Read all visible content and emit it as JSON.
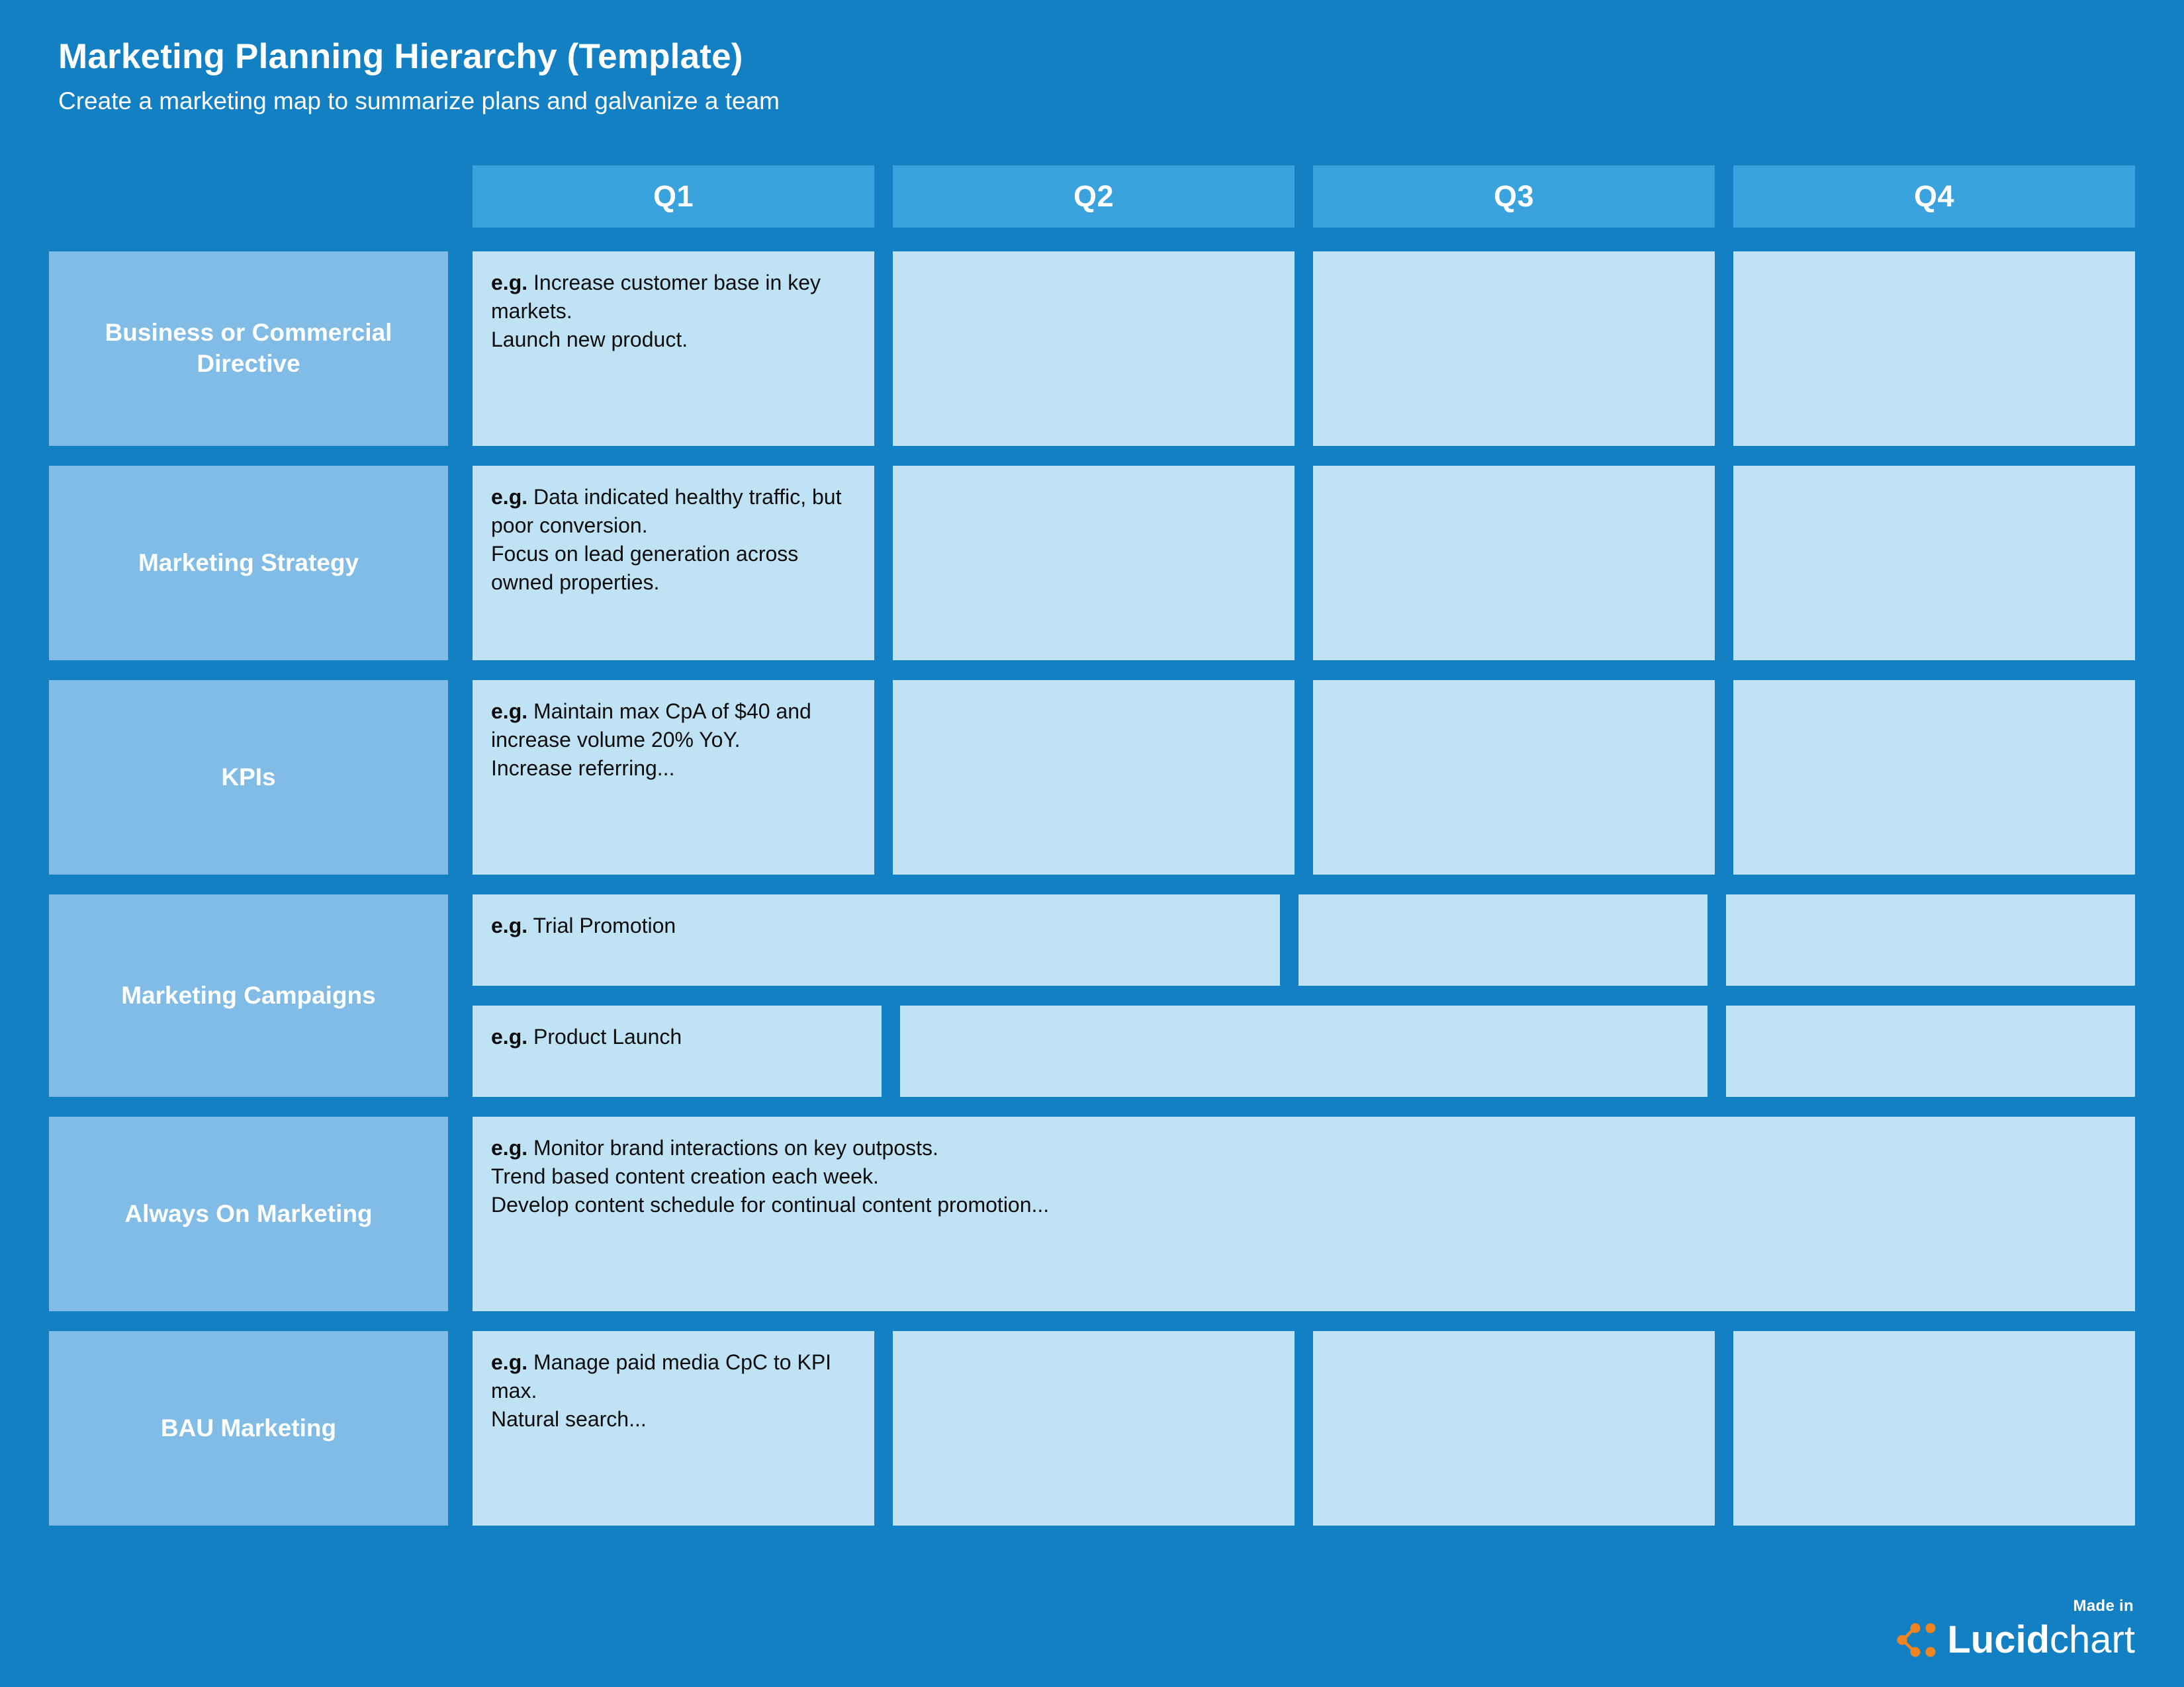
{
  "header": {
    "title": "Marketing Planning Hierarchy (Template)",
    "subtitle": "Create a marketing map to summarize plans and galvanize a team"
  },
  "colors": {
    "background": "#1280c2",
    "quarter_header": "#3aa2dd",
    "row_label": "#80bce5",
    "content_cell": "#bfe2f5",
    "text_light": "#ffffff",
    "text_dark": "#0d0d0d",
    "logo_accent": "#f08421"
  },
  "quarters": [
    {
      "label": "Q1"
    },
    {
      "label": "Q2"
    },
    {
      "label": "Q3"
    },
    {
      "label": "Q4"
    }
  ],
  "rows": [
    {
      "label": "Business or\nCommercial\nDirective",
      "cells": [
        {
          "eg": "e.g.",
          "text": " Increase customer base in key markets.\nLaunch new product."
        },
        {
          "eg": "",
          "text": ""
        },
        {
          "eg": "",
          "text": ""
        },
        {
          "eg": "",
          "text": ""
        }
      ]
    },
    {
      "label": "Marketing\nStrategy",
      "cells": [
        {
          "eg": "e.g.",
          "text": " Data indicated healthy traffic, but poor conversion.\nFocus on lead generation across owned properties."
        },
        {
          "eg": "",
          "text": ""
        },
        {
          "eg": "",
          "text": ""
        },
        {
          "eg": "",
          "text": ""
        }
      ]
    },
    {
      "label": "KPIs",
      "cells": [
        {
          "eg": "e.g.",
          "text": " Maintain max CpA of $40 and increase volume 20% YoY.\nIncrease referring..."
        },
        {
          "eg": "",
          "text": ""
        },
        {
          "eg": "",
          "text": ""
        },
        {
          "eg": "",
          "text": ""
        }
      ]
    },
    {
      "label": "Marketing\nCampaigns",
      "subrow_1": [
        {
          "eg": "e.g.",
          "text": " Trial Promotion"
        },
        {
          "eg": "",
          "text": ""
        },
        {
          "eg": "",
          "text": ""
        }
      ],
      "subrow_2": [
        {
          "eg": "e.g.",
          "text": " Product Launch"
        },
        {
          "eg": "",
          "text": ""
        },
        {
          "eg": "",
          "text": ""
        }
      ]
    },
    {
      "label": "Always On\nMarketing",
      "cells": [
        {
          "eg": "e.g.",
          "text": " Monitor brand interactions on key outposts.\nTrend based content creation each week.\nDevelop content schedule for continual content promotion..."
        }
      ]
    },
    {
      "label": "BAU\nMarketing",
      "cells": [
        {
          "eg": "e.g.",
          "text": " Manage paid media CpC to KPI max.\nNatural search..."
        },
        {
          "eg": "",
          "text": ""
        },
        {
          "eg": "",
          "text": ""
        },
        {
          "eg": "",
          "text": ""
        }
      ]
    }
  ],
  "footer": {
    "made_in": "Made in",
    "brand_bold": "Lucid",
    "brand_light": "chart",
    "logo_icon": "lucid-node-graph-icon"
  }
}
